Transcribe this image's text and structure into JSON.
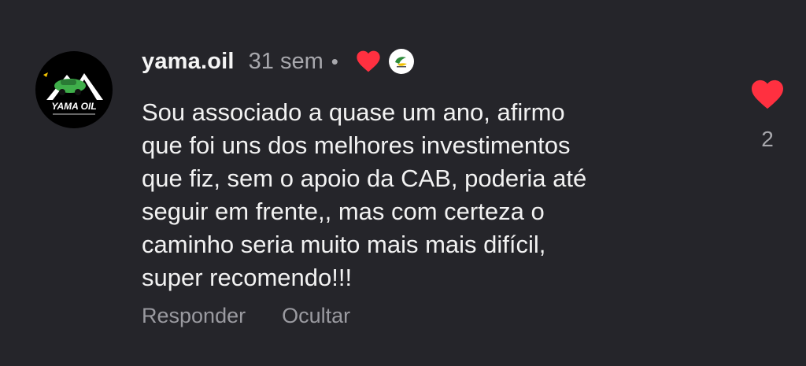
{
  "comment": {
    "avatar": {
      "logo_text": "YAMA OIL",
      "icon": "yama-oil-logo"
    },
    "username": "yama.oil",
    "time": "31 sem",
    "separator": "•",
    "author_liked_icon": "heart-filled",
    "badge_icon": "brand-badge",
    "text": "Sou associado a quase um ano, afirmo\nque foi uns dos melhores investimentos\nque fiz, sem o apoio da CAB, poderia até\nseguir em frente,, mas com certeza o\ncaminho seria muito mais mais difícil,\nsuper recomendo!!!",
    "actions": {
      "reply_label": "Responder",
      "hide_label": "Ocultar"
    },
    "like": {
      "icon": "heart-filled",
      "count": "2"
    }
  },
  "colors": {
    "background": "#25252a",
    "heart": "#ff3040",
    "muted_text": "#a8a8ad"
  }
}
